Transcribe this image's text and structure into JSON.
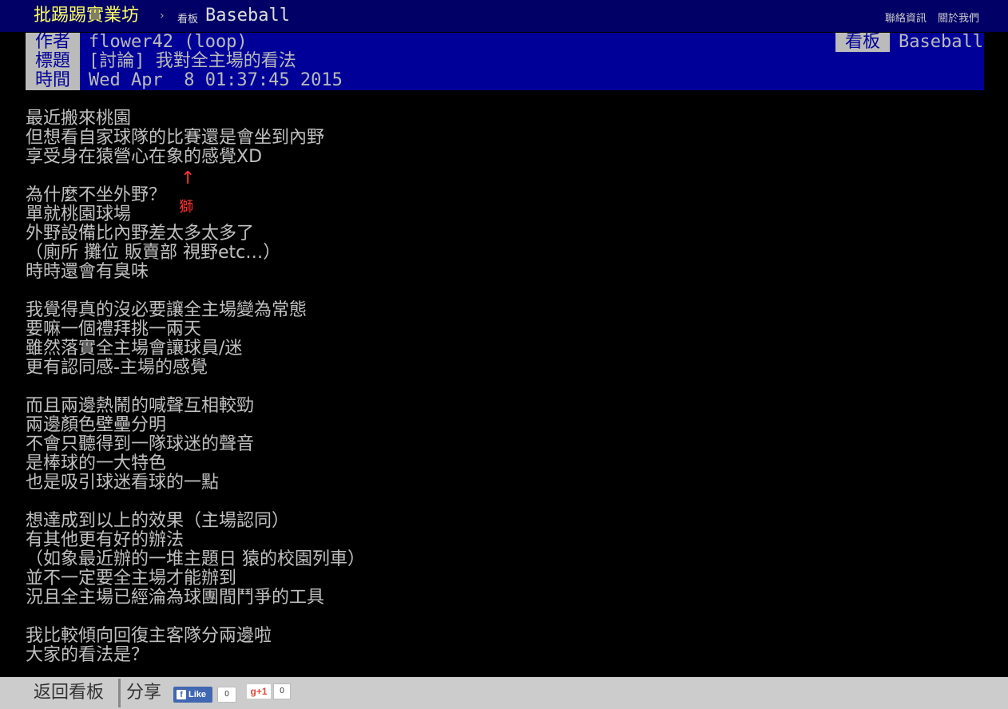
{
  "header": {
    "site_title": "批踢踢實業坊",
    "separator": "›",
    "board_label": "看板",
    "board_name": "Baseball",
    "links": [
      "聯絡資訊",
      "關於我們"
    ]
  },
  "meta": {
    "author_tag": "作者",
    "author": "flower42 (loop)",
    "title_tag": "標題",
    "title": "[討論] 我對全主場的看法",
    "time_tag": "時間",
    "time": "Wed Apr  8 01:37:45 2015",
    "board_tag": "看板",
    "board": "Baseball"
  },
  "content": {
    "lines": [
      "最近搬來桃園",
      "但想看自家球隊的比賽還是會坐到內野",
      "享受身在猿營心在象的感覺XD",
      "",
      "為什麼不坐外野？",
      "單就桃園球場",
      "外野設備比內野差太多太多了",
      "（廁所 攤位 販賣部 視野etc…）",
      "時時還會有臭味",
      "",
      "我覺得真的沒必要讓全主場變為常態",
      "要嘛一個禮拜挑一兩天",
      "雖然落實全主場會讓球員/迷",
      "更有認同感-主場的感覺",
      "",
      "而且兩邊熱鬧的喊聲互相較勁",
      "兩邊顏色壁壘分明",
      "不會只聽得到一隊球迷的聲音",
      "是棒球的一大特色",
      "也是吸引球迷看球的一點",
      "",
      "想達成到以上的效果（主場認同）",
      "有其他更有好的辦法",
      "（如象最近辦的一堆主題日 猿的校園列車）",
      "並不一定要全主場才能辦到",
      "況且全主場已經淪為球團間鬥爭的工具",
      "",
      "我比較傾向回復主客隊分兩邊啦",
      "大家的看法是？"
    ],
    "annotation_arrow": "↑",
    "annotation_text": "獅"
  },
  "footer": {
    "back_label": "返回看板",
    "share_label": "分享",
    "fb_like_label": "Like",
    "fb_count": "0",
    "gplus_label": "g+1",
    "gplus_count": "0"
  },
  "colors": {
    "top_bar": "#000066",
    "meta_bar": "#000099",
    "site_title": "#ffff66",
    "annotation": "#ff3333"
  }
}
